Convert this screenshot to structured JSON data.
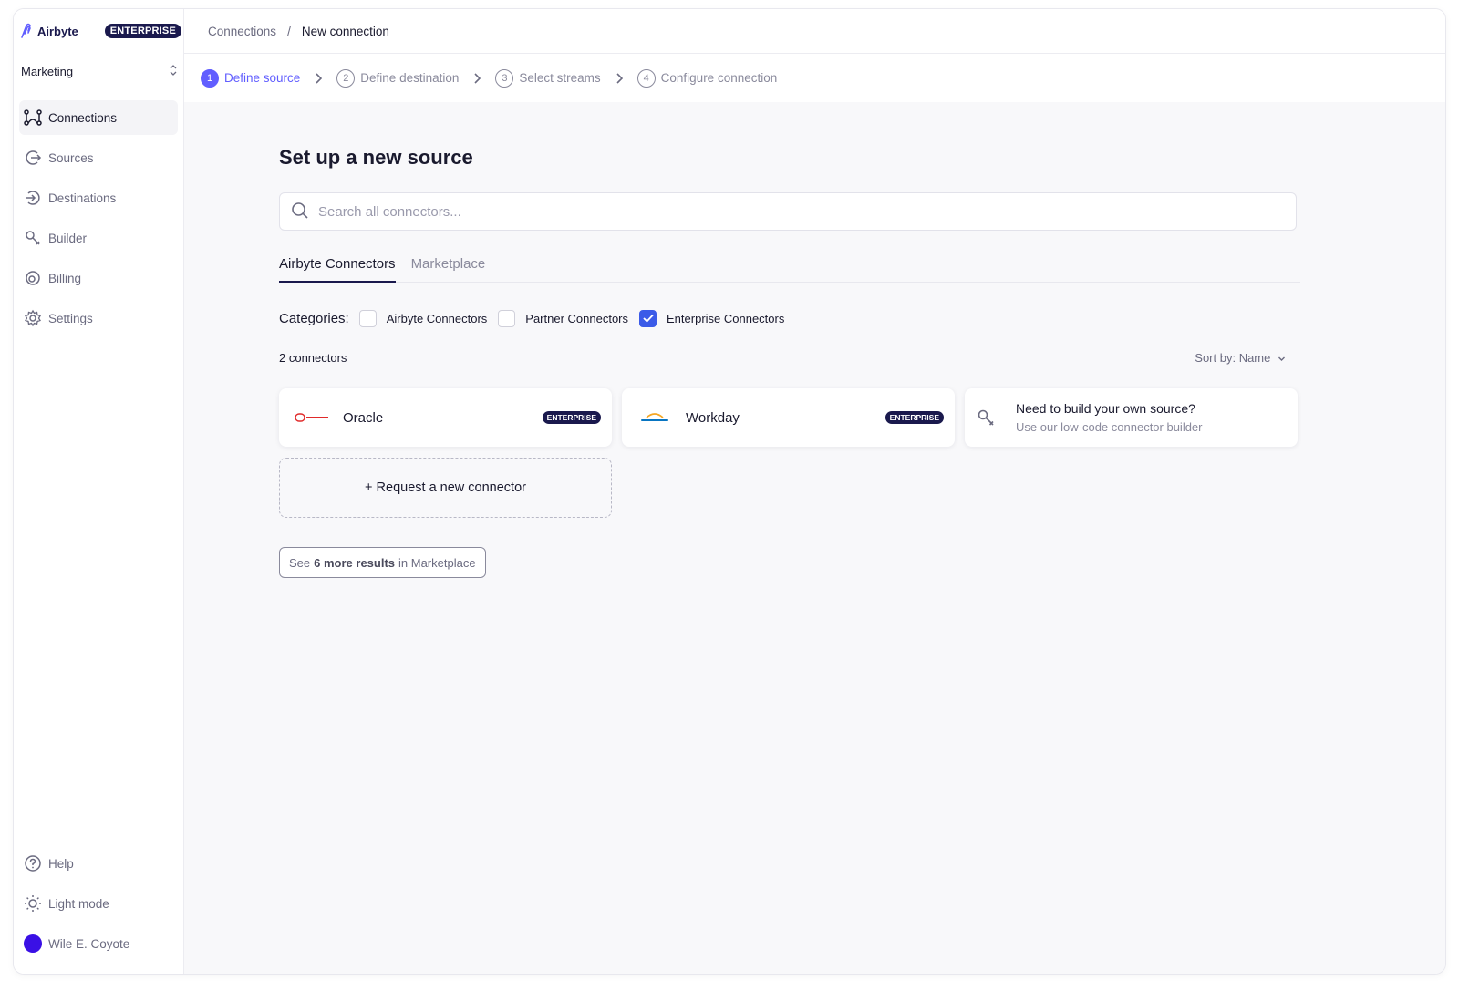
{
  "brand": {
    "name": "Airbyte",
    "badge": "ENTERPRISE"
  },
  "workspace": {
    "name": "Marketing"
  },
  "sidebar": {
    "items": [
      {
        "label": "Connections",
        "icon": "connections-icon",
        "active": true
      },
      {
        "label": "Sources",
        "icon": "sources-icon",
        "active": false
      },
      {
        "label": "Destinations",
        "icon": "destinations-icon",
        "active": false
      },
      {
        "label": "Builder",
        "icon": "builder-icon",
        "active": false
      },
      {
        "label": "Billing",
        "icon": "billing-icon",
        "active": false
      },
      {
        "label": "Settings",
        "icon": "gear-icon",
        "active": false
      }
    ],
    "bottom": [
      {
        "label": "Help",
        "icon": "help-icon"
      },
      {
        "label": "Light mode",
        "icon": "sun-icon"
      },
      {
        "label": "Wile E. Coyote",
        "icon": "avatar"
      }
    ]
  },
  "breadcrumb": {
    "parent": "Connections",
    "separator": "/",
    "current": "New connection"
  },
  "steps": [
    {
      "num": "1",
      "label": "Define source",
      "active": true
    },
    {
      "num": "2",
      "label": "Define destination",
      "active": false
    },
    {
      "num": "3",
      "label": "Select streams",
      "active": false
    },
    {
      "num": "4",
      "label": "Configure connection",
      "active": false
    }
  ],
  "main": {
    "title": "Set up a new source",
    "search_placeholder": "Search all connectors...",
    "tabs": [
      "Airbyte Connectors",
      "Marketplace"
    ],
    "categories_label": "Categories:",
    "categories": [
      {
        "label": "Airbyte Connectors",
        "checked": false
      },
      {
        "label": "Partner Connectors",
        "checked": false
      },
      {
        "label": "Enterprise Connectors",
        "checked": true
      }
    ],
    "result_count": "2 connectors",
    "sort_label": "Sort by: Name",
    "connectors": [
      {
        "name": "Oracle",
        "badge": "ENTERPRISE",
        "logo": "oracle-logo"
      },
      {
        "name": "Workday",
        "badge": "ENTERPRISE",
        "logo": "workday-logo"
      }
    ],
    "builder_card": {
      "title": "Need to build your own source?",
      "subtitle": "Use our low-code connector builder"
    },
    "request_label": "+ Request a new connector",
    "see_more": {
      "prefix": "See",
      "bold": "6 more results",
      "suffix": "in Marketplace"
    }
  },
  "colors": {
    "accent": "#615eff",
    "brand_dark": "#1a194d",
    "checkbox_checked": "#3b5be8",
    "avatar": "#3a10e5"
  }
}
